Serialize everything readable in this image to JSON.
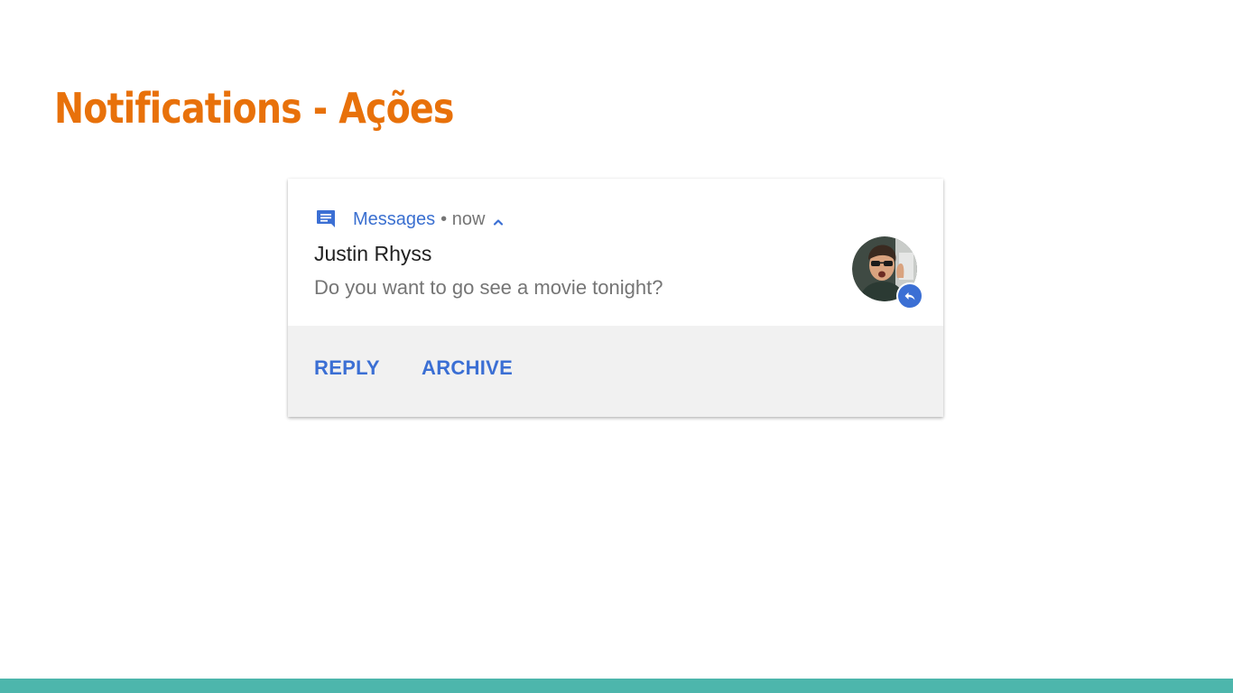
{
  "slide": {
    "title": "Notifications - Ações"
  },
  "notification": {
    "app_icon": "messages-icon",
    "app_name": "Messages",
    "meta": "• now",
    "expand_icon": "chevron-up-icon",
    "sender": "Justin Rhyss",
    "message": "Do you want to go see a movie tonight?",
    "avatar_icon": "contact-photo",
    "badge_icon": "reply-icon",
    "actions": [
      {
        "label": "REPLY"
      },
      {
        "label": "ARCHIVE"
      }
    ]
  },
  "colors": {
    "title": "#e8710a",
    "accent_blue": "#3b6fd4",
    "secondary_text": "#757575",
    "primary_text": "#212121",
    "actions_background": "#f1f1f1",
    "footer_bar": "#4db6ac"
  }
}
